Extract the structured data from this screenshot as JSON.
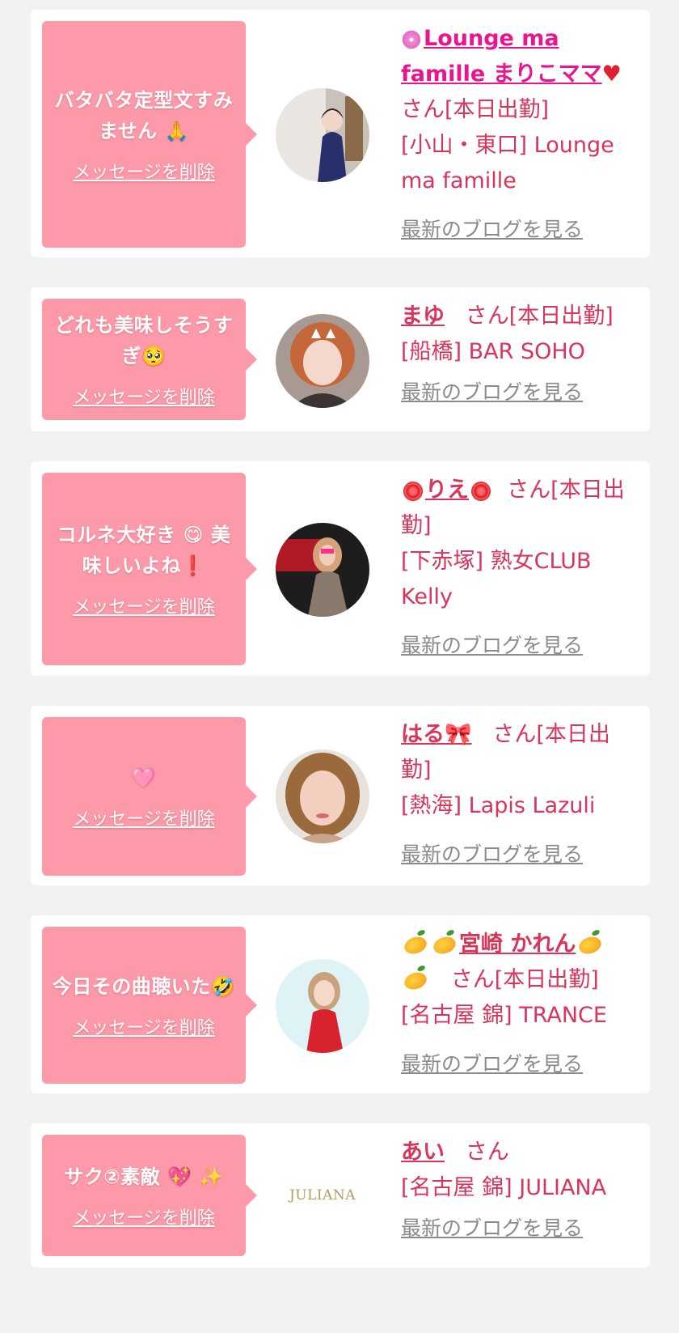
{
  "delete_label": "メッセージを削除",
  "blog_label": "最新のブログを見る",
  "cards": [
    {
      "message": "バタバタ定型文すみません 🙏",
      "name": "Lounge ma famille まりこママ",
      "honorific": "さん[本日出勤]",
      "shop": "[小山・東口] Lounge ma famille"
    },
    {
      "message": "どれも美味しそうすぎ🥺",
      "name": "まゆ",
      "honorific": "さん[本日出勤]",
      "shop": "[船橋] BAR SOHO"
    },
    {
      "message": "コルネ大好き 😋 美味しいよね❗",
      "name": "りえ",
      "honorific": "さん[本日出勤]",
      "shop": "[下赤塚] 熟女CLUB Kelly"
    },
    {
      "message": "🩷",
      "name": "はる🎀",
      "honorific": "さん[本日出勤]",
      "shop": "[熱海] Lapis Lazuli"
    },
    {
      "message": "今日その曲聴いた🤣",
      "name": "宮崎 かれん",
      "honorific": "さん[本日出勤]",
      "shop": "[名古屋 錦] TRANCE"
    },
    {
      "message": "サク②素敵 💖 ✨",
      "name": "あい",
      "honorific": "さん",
      "shop": "[名古屋 錦] JULIANA",
      "logo_text": "JULIANA"
    }
  ],
  "colors": {
    "page_bg": "#f2f2f2",
    "bubble": "#fc9aaa",
    "name_text": "#d9345a",
    "name_magenta": "#ea148f",
    "blog_link": "#8a8a8a"
  }
}
